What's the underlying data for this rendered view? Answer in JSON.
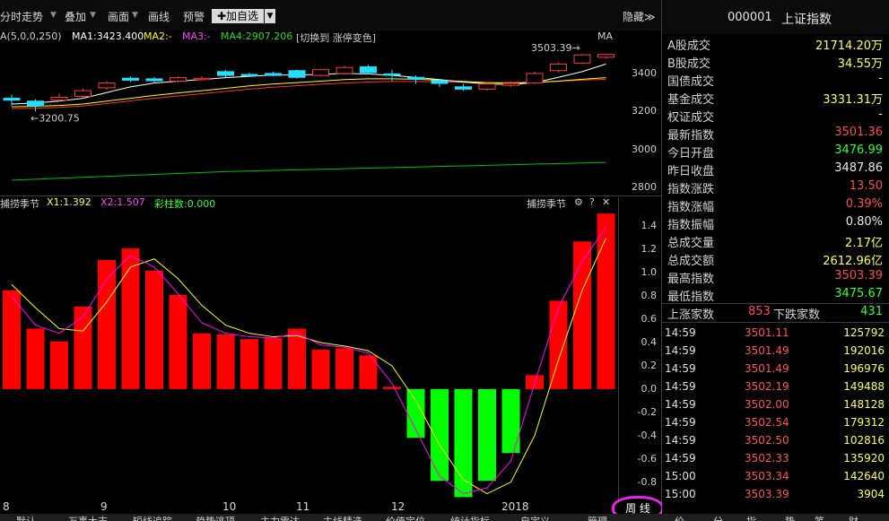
{
  "toolbar": {
    "items": [
      "分时走势",
      "叠加",
      "画面",
      "画线",
      "预警"
    ],
    "add_btn": "✚加自选",
    "hide": "隐藏≫"
  },
  "ma_legend": {
    "head": "A(5,0,0,250)",
    "ma1": "MA1:3423.400",
    "ma2": "MA2:-",
    "ma3": "MA3:-",
    "ma4": "MA4:2907.206",
    "switch": "[切换到 涨停变色]",
    "ma_tag": "MA"
  },
  "kchart_labels": {
    "high": "3503.39→",
    "low": "←3200.75"
  },
  "ind_legend": {
    "name": "捕捞季节",
    "x1": "X1:1.392",
    "x2": "X2:1.507",
    "bars": "彩柱数:0.000",
    "right_name": "捕捞季节"
  },
  "k_axis": [
    "3400",
    "3200",
    "3000",
    "2800"
  ],
  "ind_axis": [
    "1.4",
    "1.2",
    "1.0",
    "0.8",
    "0.6",
    "0.4",
    "0.2",
    "0.0",
    "-0.2",
    "-0.4",
    "-0.6",
    "-0.8"
  ],
  "x_axis": [
    "8",
    "9",
    "10",
    "11",
    "12",
    "2018"
  ],
  "week_btn": "周 线",
  "bottom_tabs": [
    "默认",
    "万事大吉",
    "短线追踪",
    "趋势逃顶",
    "主力雷达",
    "主线精选",
    "价值定位",
    "统计指标",
    "自定义",
    "管理"
  ],
  "bottom_right": [
    "价",
    "分",
    "指",
    "势",
    "笔",
    "财"
  ],
  "colors": {
    "up": "#ff0000",
    "down": "#00ff00",
    "ma_white": "#ffffff",
    "ma_yellow": "#ffff00",
    "ma_magenta": "#ff00ff",
    "ma_green": "#00c000"
  },
  "panel": {
    "code": "000001",
    "name": "上证指数",
    "stats": [
      {
        "label": "A股成交",
        "value": "21714.20万",
        "color": "yel"
      },
      {
        "label": "B股成交",
        "value": "34.55万",
        "color": "yel"
      },
      {
        "label": "国债成交",
        "value": "-",
        "color": "yel"
      },
      {
        "label": "基金成交",
        "value": "3331.31万",
        "color": "yel"
      },
      {
        "label": "权证成交",
        "value": "-",
        "color": "yel"
      },
      {
        "label": "最新指数",
        "value": "3501.36",
        "color": "red"
      },
      {
        "label": "今日开盘",
        "value": "3476.99",
        "color": "grn"
      },
      {
        "label": "昨日收盘",
        "value": "3487.86",
        "color": "wht"
      },
      {
        "label": "指数涨跌",
        "value": "13.50",
        "color": "red"
      },
      {
        "label": "指数涨幅",
        "value": "0.39%",
        "color": "red"
      },
      {
        "label": "指数振幅",
        "value": "0.80%",
        "color": "wht"
      },
      {
        "label": "总成交量",
        "value": "2.17亿",
        "color": "yel"
      },
      {
        "label": "总成交额",
        "value": "2612.96亿",
        "color": "yel"
      },
      {
        "label": "最高指数",
        "value": "3503.39",
        "color": "red"
      },
      {
        "label": "最低指数",
        "value": "3475.67",
        "color": "grn"
      }
    ],
    "updown": {
      "up_label": "上涨家数",
      "up": "853",
      "down_label": "下跌家数",
      "down": "431"
    },
    "ticks": [
      {
        "time": "14:59",
        "price": "3501.11",
        "vol": "125792"
      },
      {
        "time": "14:59",
        "price": "3501.49",
        "vol": "192016"
      },
      {
        "time": "14:59",
        "price": "3501.49",
        "vol": "196976"
      },
      {
        "time": "14:59",
        "price": "3502.19",
        "vol": "149488"
      },
      {
        "time": "14:59",
        "price": "3502.00",
        "vol": "148128"
      },
      {
        "time": "14:59",
        "price": "3502.54",
        "vol": "179312"
      },
      {
        "time": "14:59",
        "price": "3502.50",
        "vol": "102816"
      },
      {
        "time": "14:59",
        "price": "3502.33",
        "vol": "135920"
      },
      {
        "time": "15:00",
        "price": "3503.34",
        "vol": "142640"
      },
      {
        "time": "15:00",
        "price": "3503.39",
        "vol": "3904"
      }
    ]
  },
  "chart_data": [
    {
      "type": "candlestick",
      "ylim": [
        2750,
        3560
      ],
      "candles": [
        {
          "o": 3270,
          "c": 3260,
          "h": 3290,
          "l": 3230,
          "up": false
        },
        {
          "o": 3255,
          "c": 3230,
          "h": 3265,
          "l": 3200.75,
          "up": false
        },
        {
          "o": 3260,
          "c": 3275,
          "h": 3295,
          "l": 3255,
          "up": true
        },
        {
          "o": 3280,
          "c": 3310,
          "h": 3320,
          "l": 3270,
          "up": true
        },
        {
          "o": 3325,
          "c": 3350,
          "h": 3360,
          "l": 3315,
          "up": true
        },
        {
          "o": 3375,
          "c": 3365,
          "h": 3385,
          "l": 3355,
          "up": false
        },
        {
          "o": 3372,
          "c": 3362,
          "h": 3382,
          "l": 3350,
          "up": false
        },
        {
          "o": 3360,
          "c": 3378,
          "h": 3385,
          "l": 3352,
          "up": true
        },
        {
          "o": 3372,
          "c": 3375,
          "h": 3385,
          "l": 3365,
          "up": true
        },
        {
          "o": 3410,
          "c": 3390,
          "h": 3418,
          "l": 3380,
          "up": false
        },
        {
          "o": 3395,
          "c": 3390,
          "h": 3405,
          "l": 3385,
          "up": false
        },
        {
          "o": 3400,
          "c": 3390,
          "h": 3410,
          "l": 3385,
          "up": false
        },
        {
          "o": 3415,
          "c": 3380,
          "h": 3420,
          "l": 3372,
          "up": false
        },
        {
          "o": 3390,
          "c": 3420,
          "h": 3425,
          "l": 3385,
          "up": true
        },
        {
          "o": 3400,
          "c": 3432,
          "h": 3440,
          "l": 3395,
          "up": true
        },
        {
          "o": 3435,
          "c": 3405,
          "h": 3445,
          "l": 3395,
          "up": false
        },
        {
          "o": 3398,
          "c": 3395,
          "h": 3420,
          "l": 3360,
          "up": false
        },
        {
          "o": 3380,
          "c": 3370,
          "h": 3390,
          "l": 3345,
          "up": false
        },
        {
          "o": 3362,
          "c": 3348,
          "h": 3372,
          "l": 3330,
          "up": false
        },
        {
          "o": 3330,
          "c": 3318,
          "h": 3345,
          "l": 3310,
          "up": false
        },
        {
          "o": 3318,
          "c": 3345,
          "h": 3352,
          "l": 3310,
          "up": true
        },
        {
          "o": 3338,
          "c": 3348,
          "h": 3360,
          "l": 3330,
          "up": true
        },
        {
          "o": 3350,
          "c": 3400,
          "h": 3410,
          "l": 3345,
          "up": true
        },
        {
          "o": 3415,
          "c": 3450,
          "h": 3458,
          "l": 3405,
          "up": true
        },
        {
          "o": 3455,
          "c": 3498,
          "h": 3505,
          "l": 3450,
          "up": true
        },
        {
          "o": 3485,
          "c": 3500,
          "h": 3503.39,
          "l": 3478,
          "up": true
        }
      ],
      "ma_white": [
        3240,
        3245,
        3255,
        3270,
        3300,
        3330,
        3350,
        3360,
        3368,
        3378,
        3385,
        3392,
        3392,
        3395,
        3400,
        3398,
        3390,
        3380,
        3368,
        3355,
        3345,
        3342,
        3352,
        3380,
        3410,
        3450
      ],
      "ma_yellow": [
        3225,
        3228,
        3232,
        3240,
        3255,
        3270,
        3285,
        3298,
        3310,
        3322,
        3335,
        3345,
        3352,
        3360,
        3368,
        3372,
        3372,
        3370,
        3365,
        3358,
        3352,
        3350,
        3352,
        3360,
        3370,
        3378
      ],
      "ma_magenta": [
        3215,
        3218,
        3222,
        3230,
        3242,
        3256,
        3270,
        3282,
        3294,
        3306,
        3318,
        3328,
        3336,
        3344,
        3350,
        3355,
        3358,
        3358,
        3356,
        3354,
        3352,
        3352,
        3355,
        3360,
        3365,
        3370
      ],
      "ma_green": [
        2840,
        2845,
        2850,
        2855,
        2860,
        2865,
        2870,
        2875,
        2880,
        2885,
        2888,
        2891,
        2894,
        2897,
        2900,
        2903,
        2906,
        2909,
        2912,
        2915,
        2918,
        2921,
        2924,
        2927,
        2930,
        2933
      ]
    },
    {
      "type": "bar",
      "title": "捕捞季节",
      "ylim": [
        -0.95,
        1.55
      ],
      "values": [
        0.85,
        0.52,
        0.41,
        0.71,
        1.11,
        1.21,
        1.02,
        0.81,
        0.48,
        0.47,
        0.43,
        0.44,
        0.52,
        0.34,
        0.35,
        0.29,
        0.02,
        -0.42,
        -0.79,
        -0.93,
        -0.79,
        -0.55,
        0.12,
        0.76,
        1.27,
        1.51
      ],
      "x1": [
        0.8,
        0.55,
        0.48,
        0.62,
        0.95,
        1.15,
        1.05,
        0.82,
        0.57,
        0.48,
        0.45,
        0.44,
        0.48,
        0.38,
        0.36,
        0.31,
        0.05,
        -0.35,
        -0.75,
        -0.9,
        -0.85,
        -0.62,
        0.05,
        0.7,
        1.1,
        1.39
      ],
      "x2": [
        0.9,
        0.7,
        0.52,
        0.5,
        0.75,
        1.05,
        1.12,
        0.95,
        0.72,
        0.55,
        0.48,
        0.45,
        0.46,
        0.4,
        0.37,
        0.33,
        0.2,
        -0.1,
        -0.48,
        -0.78,
        -0.9,
        -0.8,
        -0.4,
        0.25,
        0.85,
        1.3
      ]
    }
  ]
}
